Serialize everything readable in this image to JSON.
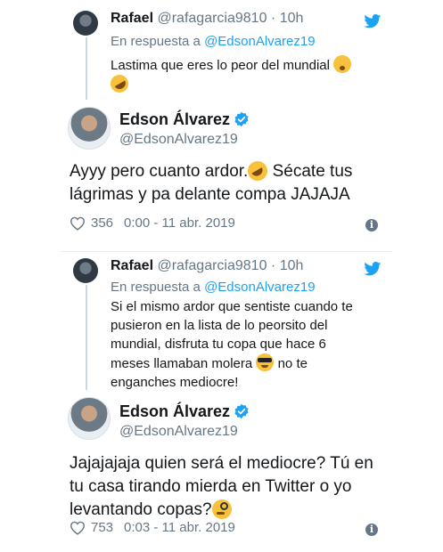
{
  "tweets": [
    {
      "reply": {
        "name": "Rafael",
        "handle": "@rafagarcia9810",
        "time": "· 10h",
        "in_reply_prefix": "En respuesta a",
        "in_reply_handle": "@EdsonAlvarez19",
        "text": "Lastima que eres lo peor del mundial"
      },
      "main": {
        "name": "Edson Álvarez",
        "handle": "@EdsonAlvarez19",
        "text_part1": "Ayyy pero cuanto ardor.",
        "text_part2": " Sécate tus lágrimas y pa delante compa JAJAJA",
        "likes": "356",
        "timestamp": "0:00 - 11 abr. 2019"
      }
    },
    {
      "reply": {
        "name": "Rafael",
        "handle": "@rafagarcia9810",
        "time": "· 10h",
        "in_reply_prefix": "En respuesta a",
        "in_reply_handle": "@EdsonAlvarez19",
        "text_part1": "Si el mismo ardor que sentiste cuando te pusieron en la lista de lo peorsito del mundial, disfruta tu copa que hace 6 meses llamaban molera",
        "text_part2": " no te enganches mediocre!"
      },
      "main": {
        "name": "Edson Álvarez",
        "handle": "@EdsonAlvarez19",
        "text": "Jajajajaja quien será el mediocre? Tú en tu casa tirando mierda en Twitter o yo levantando copas?",
        "likes": "753",
        "timestamp": "0:03 - 11 abr. 2019"
      }
    }
  ],
  "icons": {
    "twitter": "twitter-bird-icon",
    "verified": "verified-badge-icon",
    "heart": "heart-outline-icon",
    "info": "info-icon"
  },
  "colors": {
    "twitter_blue": "#1da1f2",
    "secondary_text": "#657786",
    "primary_text": "#14171a"
  }
}
